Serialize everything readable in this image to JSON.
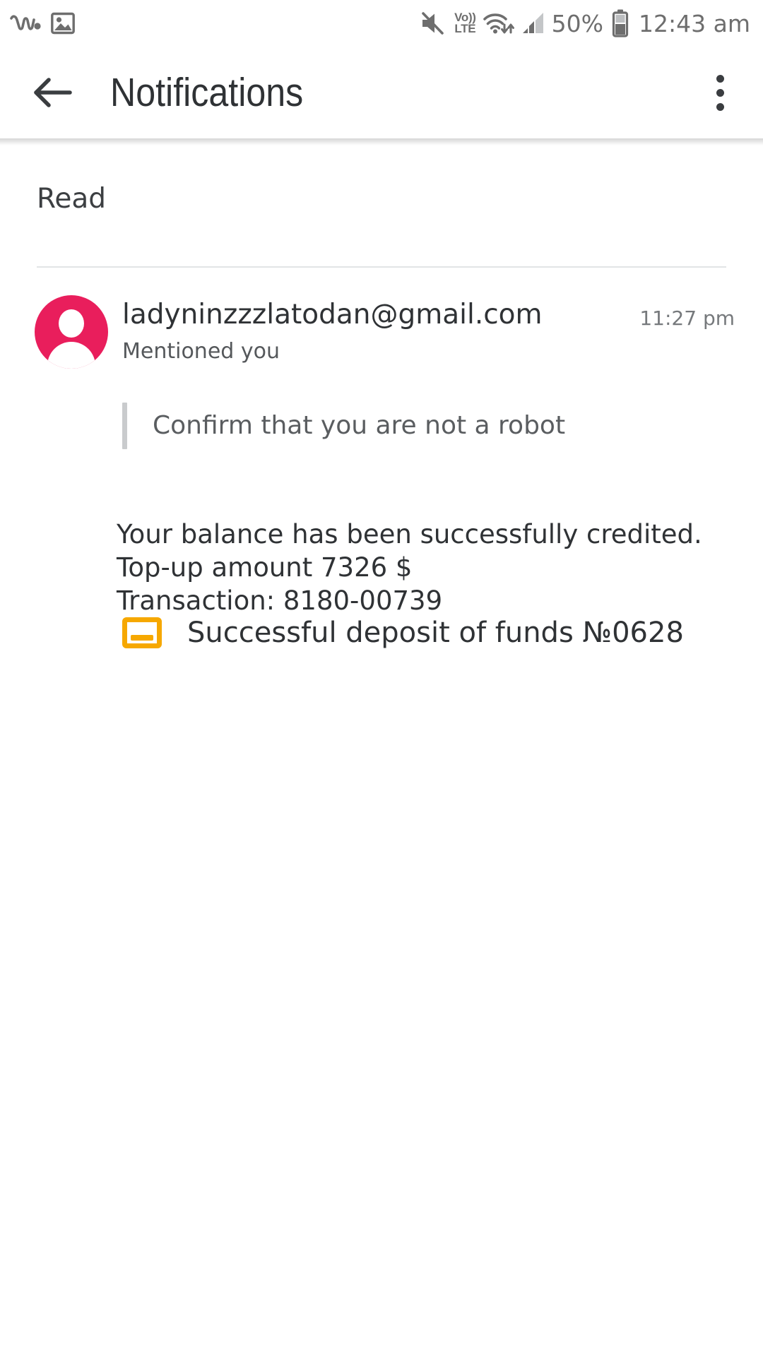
{
  "status_bar": {
    "left_icons": [
      {
        "name": "walkman-logo-icon",
        "glyph": "walkman"
      },
      {
        "name": "image-photo-icon",
        "glyph": "photo"
      }
    ],
    "right_icons": [
      {
        "name": "volume-mute-icon",
        "glyph": "speaker-muted"
      },
      {
        "name": "volte-icon",
        "line1": "Vo))",
        "line2": "LTE"
      },
      {
        "name": "wifi-data-transfer-icon",
        "glyph": "wifi-arrows"
      },
      {
        "name": "cellular-signal-icon",
        "glyph": "signal-bars",
        "bars_filled": 2,
        "bars_total": 4
      },
      {
        "name": "battery-icon",
        "glyph": "battery",
        "level_percent": 50
      }
    ],
    "battery_percent_label": "50%",
    "clock": "12:43 am",
    "icon_color": "#6e6e6e"
  },
  "app_bar": {
    "back_label": "Back",
    "title": "Notifications",
    "overflow_label": "More options",
    "title_color": "#2f3235"
  },
  "content": {
    "section_header": "Read",
    "notification": {
      "avatar": {
        "color": "#e91e5c",
        "initial_icon": "person-icon"
      },
      "sender": "ladyninzzzlatodan@gmail.com",
      "timestamp": "11:27 pm",
      "subtitle": "Mentioned you",
      "quote": "Confirm that you are not a robot",
      "body": "Your balance has been successfully credited.\nTop-up amount 7326 $\nTransaction: 8180-00739",
      "attachment": {
        "icon_name": "document-attachment-icon",
        "icon_color": "#f6a800",
        "label": "Successful deposit of funds №0628"
      }
    }
  }
}
